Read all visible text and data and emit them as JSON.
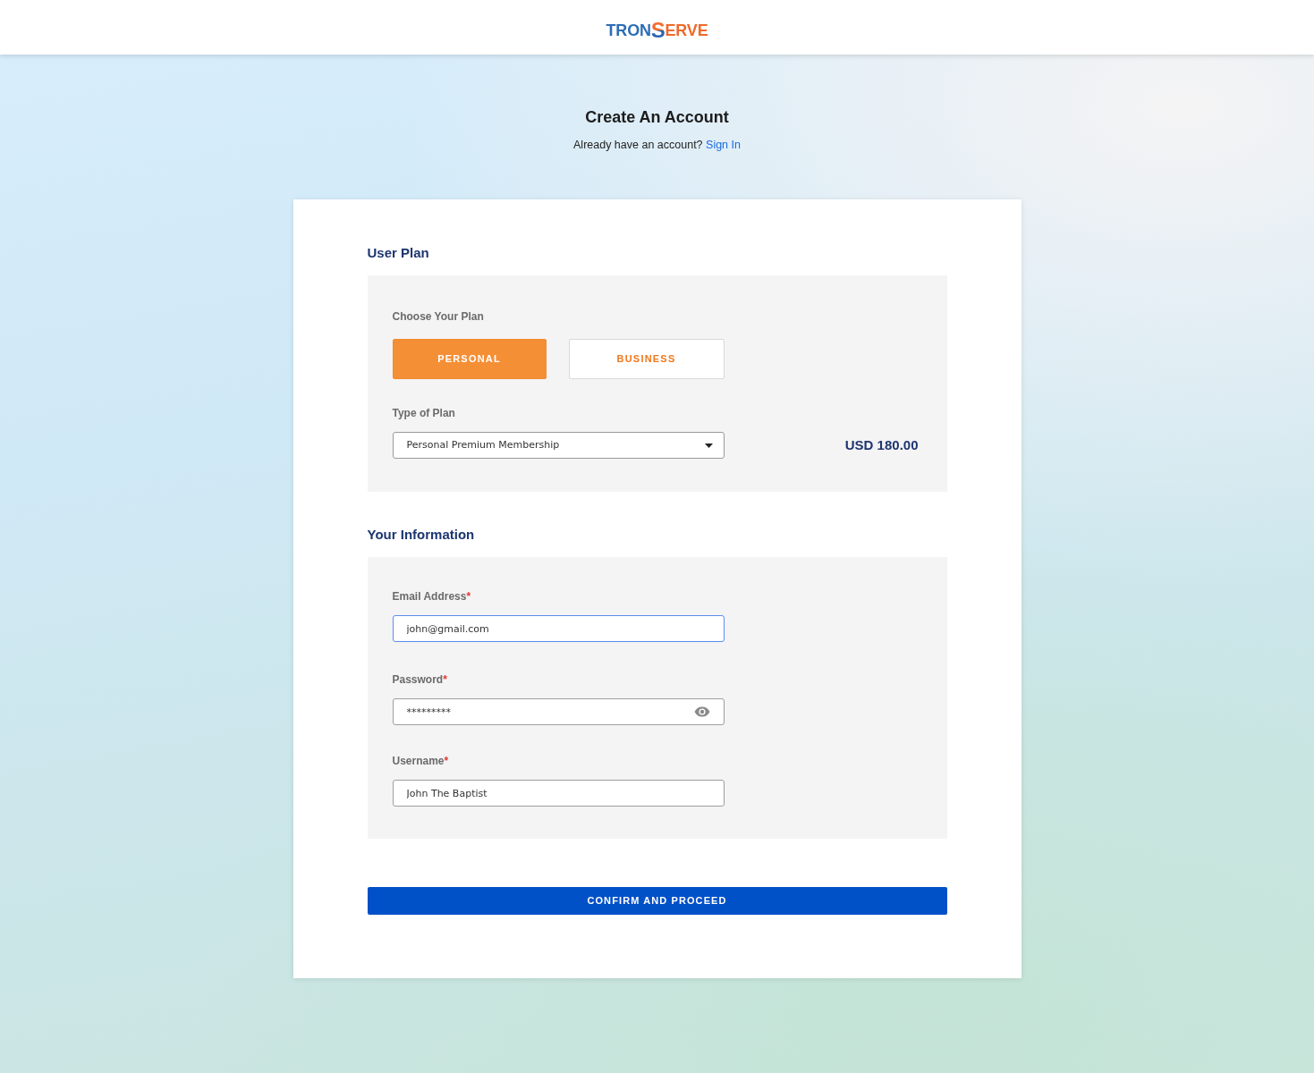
{
  "header": {
    "logo": {
      "prefix": "TRON",
      "mark": "S",
      "suffix": "ERVE"
    }
  },
  "intro": {
    "title": "Create An Account",
    "prompt": "Already have an account?",
    "link": "Sign In"
  },
  "user_plan": {
    "title": "User Plan",
    "choose_label": "Choose Your Plan",
    "plans": [
      {
        "label": "PERSONAL",
        "selected": true
      },
      {
        "label": "BUSINESS",
        "selected": false
      }
    ],
    "type_label": "Type of Plan",
    "type_value": "Personal Premium Membership",
    "price": "USD 180.00"
  },
  "your_information": {
    "title": "Your Information",
    "fields": [
      {
        "kind": "text",
        "label": "Email Address",
        "required_mark": "*",
        "value": "john@gmail.com",
        "focused": true
      },
      {
        "kind": "password",
        "label": "Password",
        "required_mark": "*",
        "value": "*********",
        "focused": false
      },
      {
        "kind": "text",
        "label": "Username",
        "required_mark": "*",
        "value": "John The Baptist",
        "focused": false
      }
    ]
  },
  "submit": {
    "label": "CONFIRM AND PROCEED"
  }
}
